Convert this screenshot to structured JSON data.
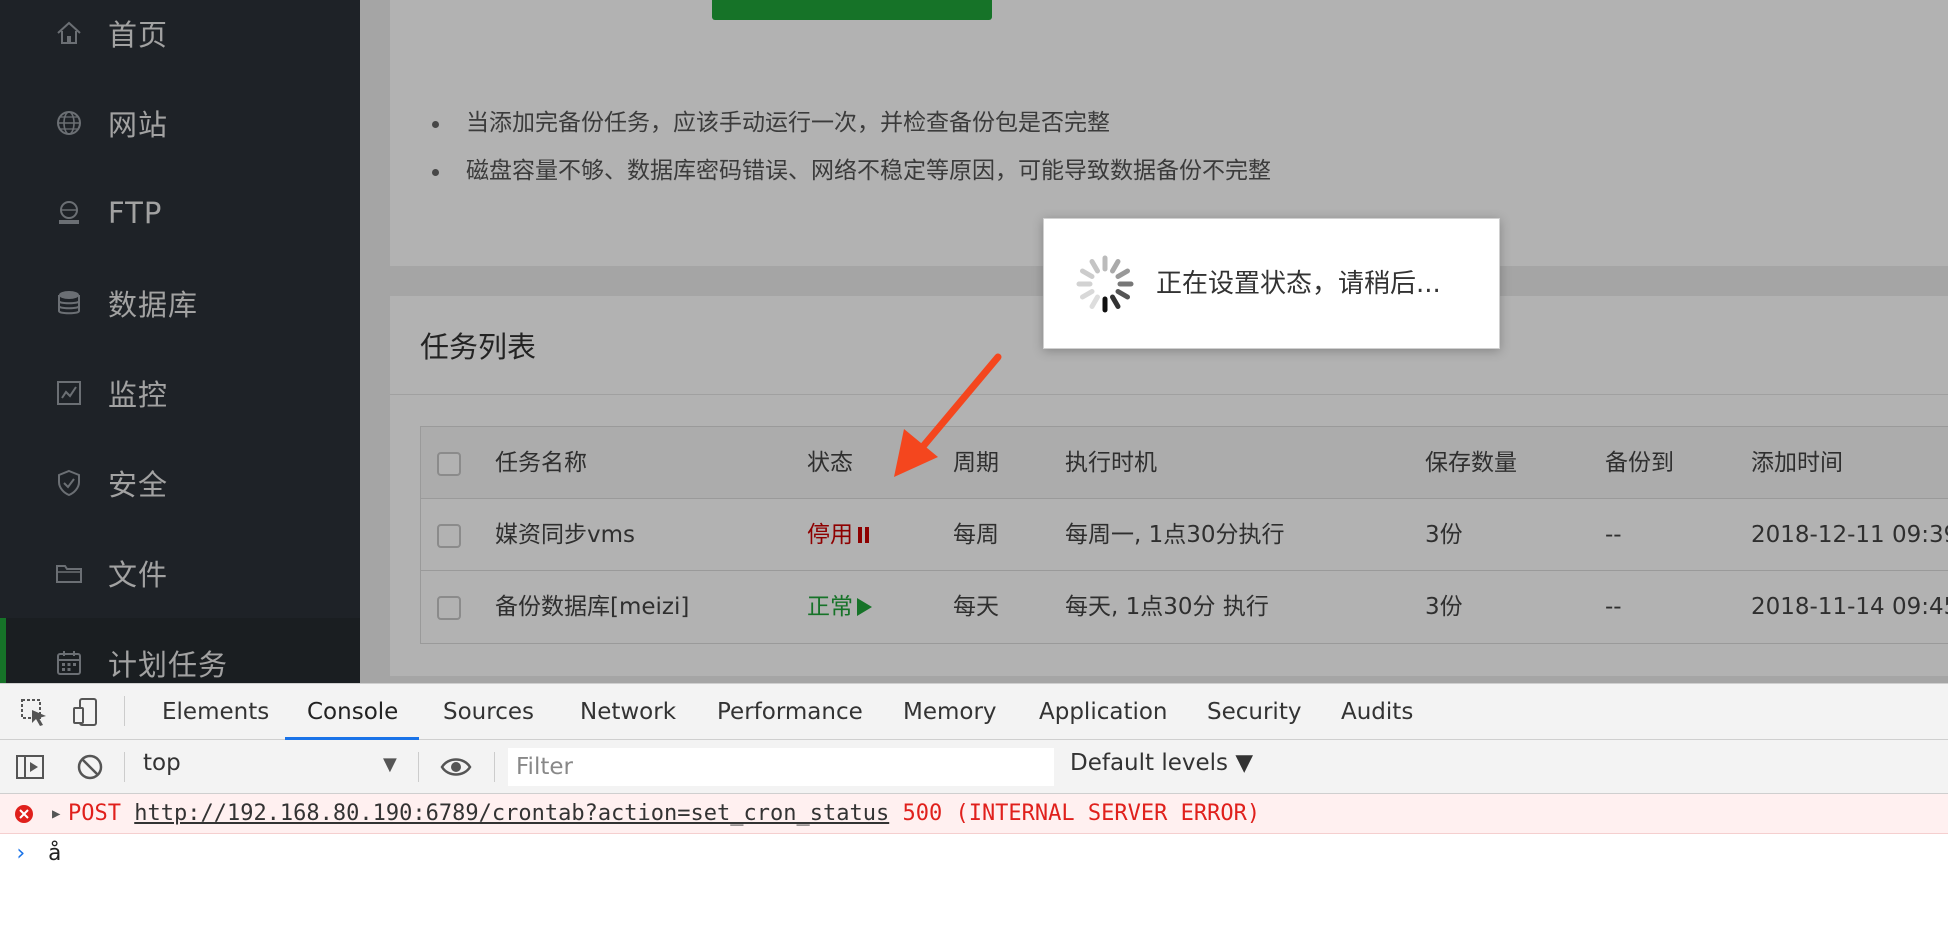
{
  "sidebar": {
    "items": [
      {
        "label": "首页",
        "icon": "home-icon"
      },
      {
        "label": "网站",
        "icon": "globe-icon"
      },
      {
        "label": "FTP",
        "icon": "ftp-icon"
      },
      {
        "label": "数据库",
        "icon": "database-icon"
      },
      {
        "label": "监控",
        "icon": "monitor-icon"
      },
      {
        "label": "安全",
        "icon": "shield-icon"
      },
      {
        "label": "文件",
        "icon": "folder-icon"
      },
      {
        "label": "计划任务",
        "icon": "calendar-icon",
        "active": true
      }
    ]
  },
  "tips": [
    "当添加完备份任务，应该手动运行一次，并检查备份包是否完整",
    "磁盘容量不够、数据库密码错误、网络不稳定等原因，可能导致数据备份不完整"
  ],
  "task_list": {
    "title": "任务列表",
    "columns": [
      "任务名称",
      "状态",
      "周期",
      "执行时机",
      "保存数量",
      "备份到",
      "添加时间"
    ],
    "rows": [
      {
        "name": "媒资同步vms",
        "status": "停用",
        "status_type": "off",
        "cycle": "每周",
        "time": "每周一, 1点30分执行",
        "keep": "3份",
        "dest": "--",
        "added": "2018-12-11 09:39:"
      },
      {
        "name": "备份数据库[meizi]",
        "status": "正常",
        "status_type": "on",
        "cycle": "每天",
        "time": "每天, 1点30分 执行",
        "keep": "3份",
        "dest": "--",
        "added": "2018-11-14 09:45:"
      }
    ]
  },
  "loading": {
    "text": "正在设置状态，请稍后..."
  },
  "devtools": {
    "tabs": [
      "Elements",
      "Console",
      "Sources",
      "Network",
      "Performance",
      "Memory",
      "Application",
      "Security",
      "Audits"
    ],
    "active_tab": "Console",
    "context": "top",
    "filter_placeholder": "Filter",
    "levels": "Default levels ▼",
    "error": {
      "method": "POST",
      "url": "http://192.168.80.190:6789/crontab?action=set_cron_status",
      "status": "500 (INTERNAL SERVER ERROR)"
    },
    "prompt_text": "å"
  },
  "colors": {
    "sidebar_bg": "#2c3138",
    "accent_green": "#20a53a",
    "status_off": "#cc0000",
    "status_on": "#20a53a",
    "arrow": "#f4461e",
    "error_text": "#e0201c"
  }
}
